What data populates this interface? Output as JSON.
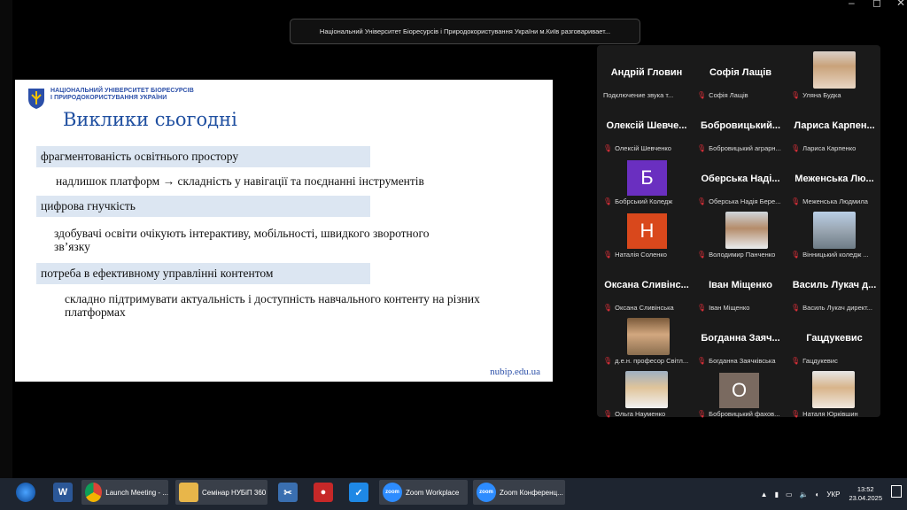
{
  "window_controls": {
    "minimize": "–",
    "maximize": "◻",
    "close": "✕"
  },
  "share_banner": "Національний Університет Біоресурсів і Природокористування України м.Київ разговаривает...",
  "slide": {
    "org_line1": "НАЦІОНАЛЬНИЙ УНІВЕРСИТЕТ БІОРЕСУРСІВ",
    "org_line2": "І ПРИРОДОКОРИСТУВАННЯ УКРАЇНИ",
    "title": "Виклики сьогодні",
    "sections": [
      {
        "heading": "фрагментованість освітнього простору",
        "body": "надлишок платформ → складність у навігації та поєднанні інструментів"
      },
      {
        "heading": "цифрова гнучкість",
        "body": "здобувачі освіти очікують інтерактиву, мобільності, швидкого зворотного зв’язку"
      },
      {
        "heading": "потреба в ефективному управлінні контентом",
        "body": "складно підтримувати актуальність і доступність навчального контенту на різних платформах"
      }
    ],
    "url": "nubip.edu.ua"
  },
  "participants": [
    {
      "display": "Андрій Гловин",
      "label": "Подключение звука т..."
    },
    {
      "display": "Софія Лащів",
      "label": "Софія Лащів"
    },
    {
      "display": "",
      "label": "Уляна Будка"
    },
    {
      "display": "Олексій Шевче...",
      "label": "Олексій Шевченко"
    },
    {
      "display": "Бобровицький...",
      "label": "Бобровицький аграрн..."
    },
    {
      "display": "Лариса Карпен...",
      "label": "Лариса Карпенко"
    },
    {
      "display": "Б",
      "label": "Бобрський Коледж"
    },
    {
      "display": "Оберська Наді...",
      "label": "Оберська Надія Бере..."
    },
    {
      "display": "Меженська Лю...",
      "label": "Меженська Людмила"
    },
    {
      "display": "Н",
      "label": "Наталія Соленко"
    },
    {
      "display": "",
      "label": "Володимир Панченко"
    },
    {
      "display": "",
      "label": "Вінницький коледж ..."
    },
    {
      "display": "Оксана Сливінс...",
      "label": "Оксана Сливінська"
    },
    {
      "display": "Іван Міщенко",
      "label": "Іван Міщенко"
    },
    {
      "display": "Василь Лукач д...",
      "label": "Василь Лукач директ..."
    },
    {
      "display": "",
      "label": "д.е.н. професор Світл..."
    },
    {
      "display": "Богданна Заяч...",
      "label": "Богданна Заячківська"
    },
    {
      "display": "Гацдукевис",
      "label": "Гацдукевис"
    },
    {
      "display": "",
      "label": "Ольга Науменко"
    },
    {
      "display": "О",
      "label": "Бобровицький фахов..."
    },
    {
      "display": "",
      "label": "Наталя Юрківшин"
    }
  ],
  "taskbar": {
    "items": [
      {
        "label": ""
      },
      {
        "label": ""
      },
      {
        "label": "Launch Meeting - ..."
      },
      {
        "label": "Семінар НУБіП 360"
      },
      {
        "label": ""
      },
      {
        "label": ""
      },
      {
        "label": ""
      },
      {
        "label": "Zoom Workplace"
      },
      {
        "label": "Zoom Конференц..."
      }
    ],
    "language": "УКР",
    "time": "13:52",
    "date": "23.04.2025"
  },
  "colors": {
    "slide_title": "#1f4fa0",
    "bar_bg": "#dce6f2",
    "mic_off": "#e5303a",
    "taskbar": "#1e2530"
  }
}
